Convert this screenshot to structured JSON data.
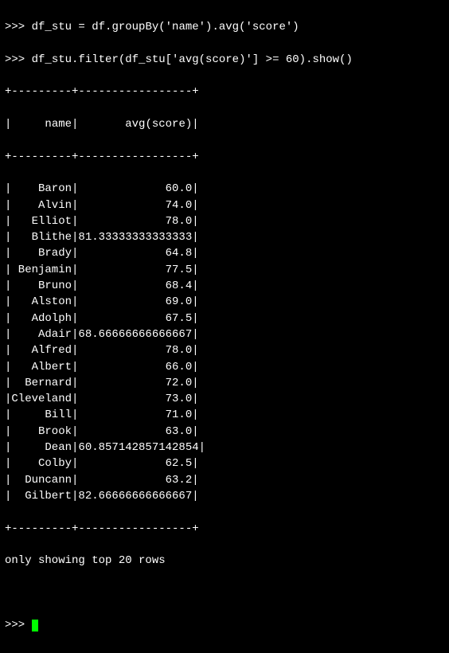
{
  "prompt_symbol": ">>>",
  "lines": {
    "cmd1": "df_stu = df.groupBy('name').avg('score')",
    "cmd2": "df_stu.filter(df_stu['avg(score)'] >= 60).show()"
  },
  "table_border": "+---------+-----------------+",
  "header": {
    "name": "     name",
    "avg": "       avg(score)"
  },
  "chart_data": {
    "type": "table",
    "columns": [
      "name",
      "avg(score)"
    ],
    "rows": [
      {
        "name": "Baron",
        "avg": 60.0,
        "avg_disp": "60.0"
      },
      {
        "name": "Alvin",
        "avg": 74.0,
        "avg_disp": "74.0"
      },
      {
        "name": "Elliot",
        "avg": 78.0,
        "avg_disp": "78.0"
      },
      {
        "name": "Blithe",
        "avg": 81.33333333333333,
        "avg_disp": "81.33333333333333"
      },
      {
        "name": "Brady",
        "avg": 64.8,
        "avg_disp": "64.8"
      },
      {
        "name": "Benjamin",
        "avg": 77.5,
        "avg_disp": "77.5"
      },
      {
        "name": "Bruno",
        "avg": 68.4,
        "avg_disp": "68.4"
      },
      {
        "name": "Alston",
        "avg": 69.0,
        "avg_disp": "69.0"
      },
      {
        "name": "Adolph",
        "avg": 67.5,
        "avg_disp": "67.5"
      },
      {
        "name": "Adair",
        "avg": 68.66666666666667,
        "avg_disp": "68.66666666666667"
      },
      {
        "name": "Alfred",
        "avg": 78.0,
        "avg_disp": "78.0"
      },
      {
        "name": "Albert",
        "avg": 66.0,
        "avg_disp": "66.0"
      },
      {
        "name": "Bernard",
        "avg": 72.0,
        "avg_disp": "72.0"
      },
      {
        "name": "Cleveland",
        "avg": 73.0,
        "avg_disp": "73.0"
      },
      {
        "name": "Bill",
        "avg": 71.0,
        "avg_disp": "71.0"
      },
      {
        "name": "Brook",
        "avg": 63.0,
        "avg_disp": "63.0"
      },
      {
        "name": "Dean",
        "avg": 60.857142857142854,
        "avg_disp": "60.857142857142854"
      },
      {
        "name": "Colby",
        "avg": 62.5,
        "avg_disp": "62.5"
      },
      {
        "name": "Duncann",
        "avg": 63.2,
        "avg_disp": "63.2"
      },
      {
        "name": "Gilbert",
        "avg": 82.66666666666667,
        "avg_disp": "82.66666666666667"
      }
    ]
  },
  "footer": "only showing top 20 rows",
  "name_width": 9,
  "avg_width": 17
}
